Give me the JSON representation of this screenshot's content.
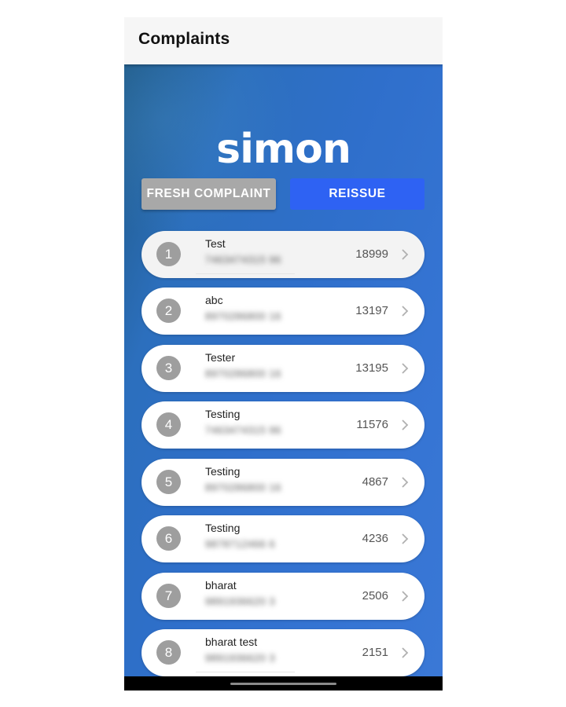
{
  "app_bar": {
    "title": "Complaints"
  },
  "logo": {
    "text": "simon"
  },
  "buttons": {
    "fresh_complaint": "FRESH COMPLAINT",
    "reissue": "REISSUE"
  },
  "complaints": [
    {
      "index": "1",
      "name": "Test",
      "phone": "7463474315 96",
      "count": "18999"
    },
    {
      "index": "2",
      "name": "abc",
      "phone": "8970286800 16",
      "count": "13197"
    },
    {
      "index": "3",
      "name": "Tester",
      "phone": "8970286800 16",
      "count": "13195"
    },
    {
      "index": "4",
      "name": "Testing",
      "phone": "7463474315 96",
      "count": "11576"
    },
    {
      "index": "5",
      "name": "Testing",
      "phone": "8970286800 16",
      "count": "4867"
    },
    {
      "index": "6",
      "name": "Testing",
      "phone": "9878712466 6",
      "count": "4236"
    },
    {
      "index": "7",
      "name": "bharat",
      "phone": "9891936620 3",
      "count": "2506"
    },
    {
      "index": "8",
      "name": "bharat test",
      "phone": "9891936620 3",
      "count": "2151"
    }
  ],
  "colors": {
    "app_bar_bg": "#f6f6f6",
    "main_bg": "#2f6fcb",
    "fresh_button": "#a8a8a8",
    "reissue_button": "#2e62f3",
    "badge": "#9e9e9e"
  }
}
